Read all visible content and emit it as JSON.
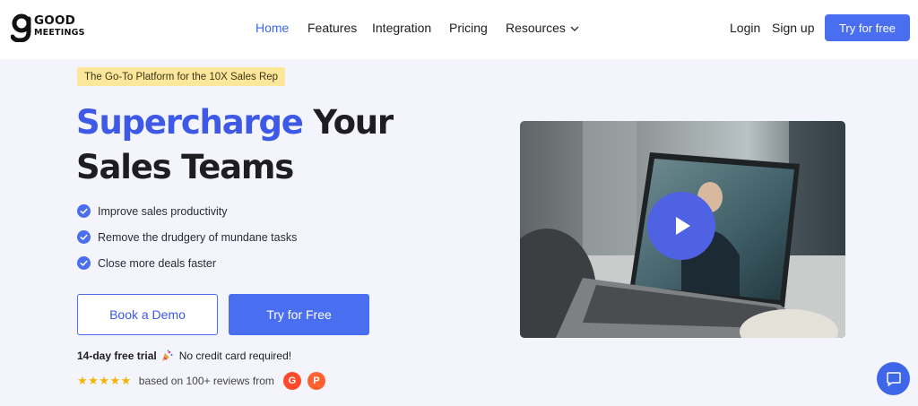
{
  "brand": {
    "line1": "GOOD",
    "line2": "MEETINGS",
    "accent": "#3d59e6",
    "button_color": "#4a6ef0"
  },
  "nav": {
    "items": [
      {
        "label": "Home",
        "active": true
      },
      {
        "label": "Features"
      },
      {
        "label": "Integration"
      },
      {
        "label": "Pricing"
      },
      {
        "label": "Resources",
        "icon": "chevron-down-icon"
      }
    ],
    "login": "Login",
    "signup": "Sign up",
    "cta": "Try for free"
  },
  "hero": {
    "badge": "The Go-To Platform for the 10X Sales Rep",
    "headline_highlight": "Supercharge",
    "headline_rest": " Your",
    "headline_line2": "Sales Teams",
    "features": [
      "Improve sales productivity",
      "Remove the drudgery of mundane tasks",
      "Close more deals faster"
    ],
    "feature_icon": "check-circle-icon",
    "book_demo": "Book a Demo",
    "try_free": "Try for Free",
    "trial_bold": "14-day free trial",
    "trial_icon": "party-popper-icon",
    "no_card": "No credit card required!",
    "stars": "★★★★★",
    "reviews_text": "based on 100+ reviews from",
    "review_logos": [
      {
        "letter": "G",
        "name": "g2-logo-icon",
        "color": "#ff492c"
      },
      {
        "letter": "P",
        "name": "product-hunt-logo-icon",
        "color": "#ff6230"
      }
    ]
  },
  "video": {
    "play_icon": "play-icon"
  },
  "chat": {
    "icon": "chat-bubble-icon"
  }
}
